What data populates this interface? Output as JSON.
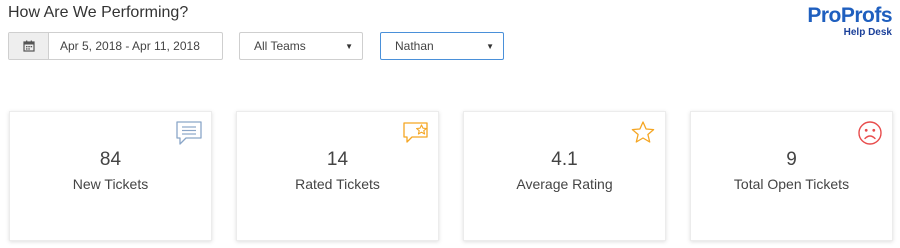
{
  "header": {
    "title": "How Are We Performing?"
  },
  "logo": {
    "brand": "ProProfs",
    "product": "Help Desk"
  },
  "filters": {
    "date_icon": "calendar-icon",
    "date_range": "Apr 5, 2018 - Apr 11, 2018",
    "team": "All Teams",
    "agent": "Nathan"
  },
  "colors": {
    "new_tickets_icon": "#8aa6c8",
    "rated_icon": "#f5a623",
    "rating_icon": "#f5a623",
    "open_icon": "#e84c4c",
    "active_select_border": "#4a90d9"
  },
  "stats": [
    {
      "value": "84",
      "label": "New Tickets",
      "icon": "chat-bubble-icon"
    },
    {
      "value": "14",
      "label": "Rated Tickets",
      "icon": "rated-chat-star-icon"
    },
    {
      "value": "4.1",
      "label": "Average Rating",
      "icon": "star-icon"
    },
    {
      "value": "9",
      "label": "Total Open Tickets",
      "icon": "sad-face-icon"
    }
  ]
}
